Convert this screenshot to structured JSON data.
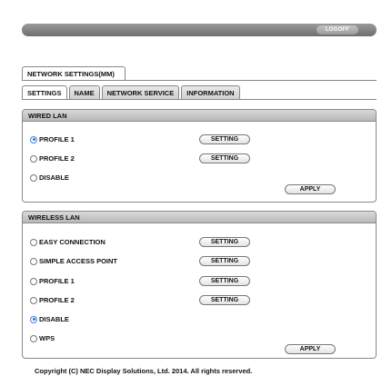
{
  "header": {
    "logoff_label": "LOGOFF"
  },
  "title_tab": "NETWORK SETTINGS(MM)",
  "tabs": [
    {
      "label": "SETTINGS",
      "active": true
    },
    {
      "label": "NAME",
      "active": false
    },
    {
      "label": "NETWORK SERVICE",
      "active": false
    },
    {
      "label": "INFORMATION",
      "active": false
    }
  ],
  "wired": {
    "title": "WIRED LAN",
    "options": [
      {
        "label": "PROFILE 1",
        "checked": true,
        "button": "SETTING"
      },
      {
        "label": "PROFILE 2",
        "checked": false,
        "button": "SETTING"
      },
      {
        "label": "DISABLE",
        "checked": false,
        "button": ""
      }
    ],
    "apply_label": "APPLY"
  },
  "wireless": {
    "title": "WIRELESS LAN",
    "options": [
      {
        "label": "EASY CONNECTION",
        "checked": false,
        "button": "SETTING"
      },
      {
        "label": "SIMPLE ACCESS POINT",
        "checked": false,
        "button": "SETTING"
      },
      {
        "label": "PROFILE 1",
        "checked": false,
        "button": "SETTING"
      },
      {
        "label": "PROFILE 2",
        "checked": false,
        "button": "SETTING"
      },
      {
        "label": "DISABLE",
        "checked": true,
        "button": ""
      },
      {
        "label": "WPS",
        "checked": false,
        "button": ""
      }
    ],
    "apply_label": "APPLY"
  },
  "footer": {
    "copyright": "Copyright (C) NEC Display Solutions, Ltd. 2014. All rights reserved."
  }
}
